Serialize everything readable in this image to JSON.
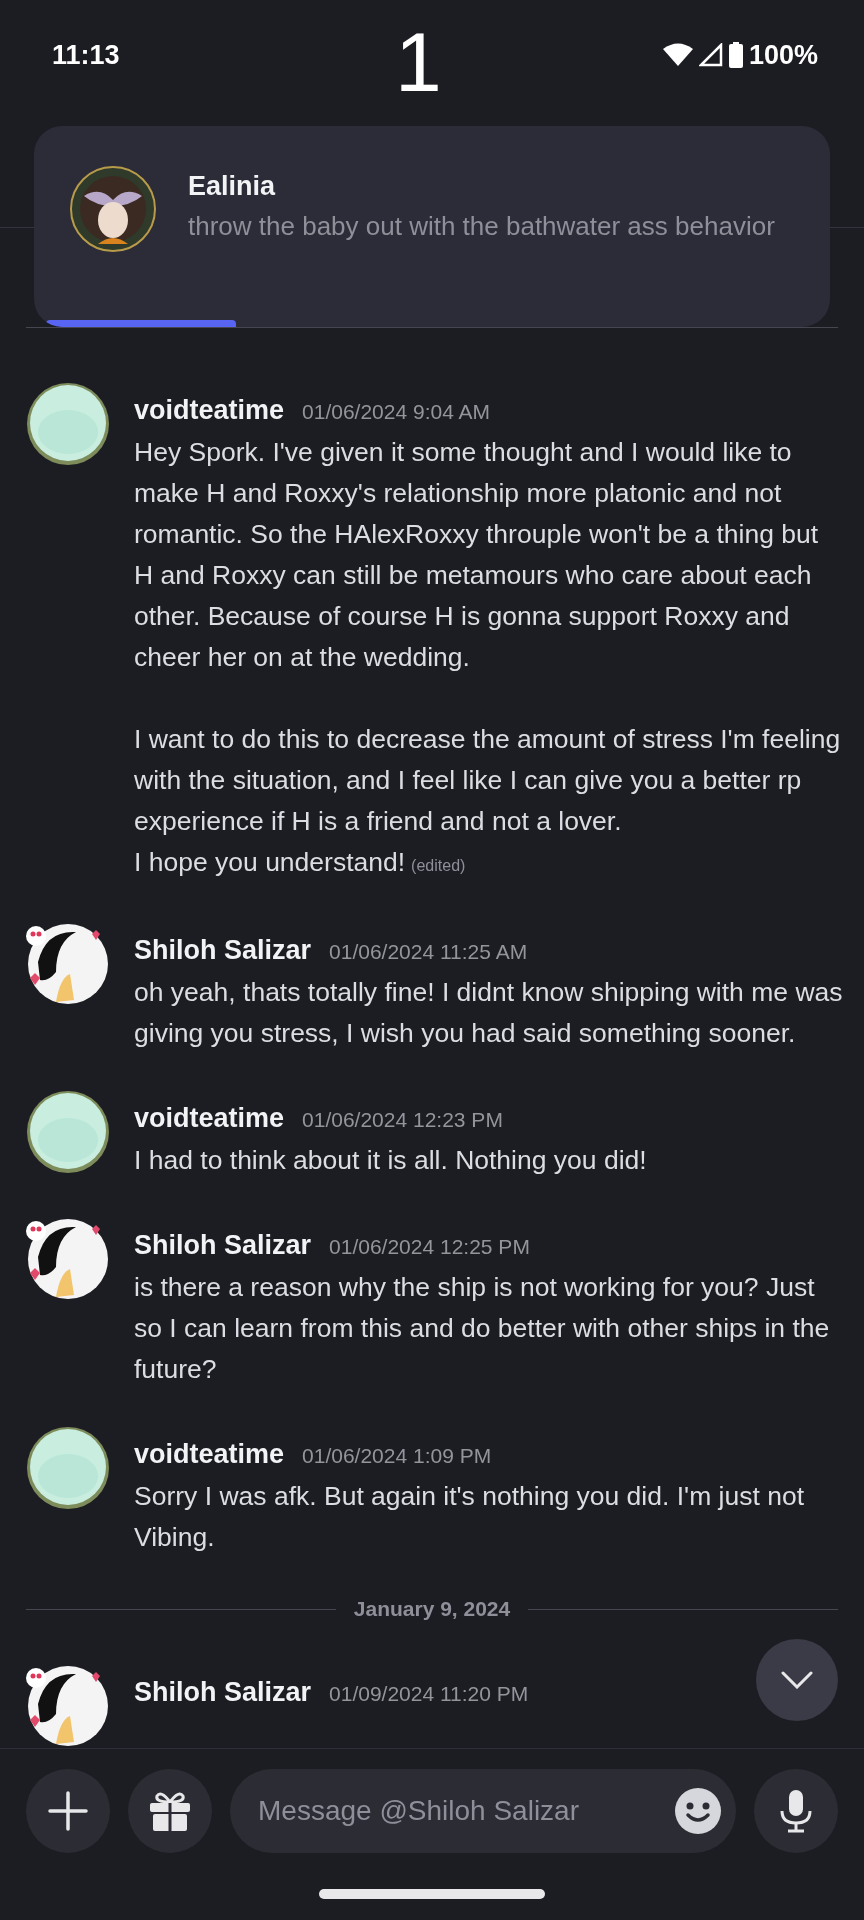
{
  "status_bar": {
    "time": "11:13",
    "center_text": "1",
    "battery": "100%"
  },
  "notification": {
    "author": "Ealinia",
    "text": "throw the baby out with the bathwater ass behavior"
  },
  "feed": [
    {
      "kind": "rule"
    },
    {
      "kind": "message",
      "avatar": {
        "kind": "mint"
      },
      "author": "voidteatime",
      "time": "01/06/2024 9:04 AM",
      "text": "Hey Spork. I've given it some thought and I would like to make H and Roxxy's relationship more platonic and not romantic. So the HAlexRoxxy throuple won't be a thing but H and Roxxy can still be metamours who care about each other. Because of course H is gonna support Roxxy and cheer her on at the wedding.\n\nI want to do this to decrease the amount of stress I'm feeling with the situation, and I feel like I can give you a better rp experience if H is a friend and not a lover.\nI hope you understand!",
      "edited_label": "(edited)"
    },
    {
      "kind": "message",
      "avatar": {
        "kind": "sketch"
      },
      "author": "Shiloh Salizar",
      "time": "01/06/2024 11:25 AM",
      "text": "oh yeah, thats totally fine! I didnt know shipping with me was giving you stress, I wish you had said something sooner."
    },
    {
      "kind": "message",
      "avatar": {
        "kind": "mint"
      },
      "author": "voidteatime",
      "time": "01/06/2024 12:23 PM",
      "text": "I had to think about it is all. Nothing you did!"
    },
    {
      "kind": "message",
      "avatar": {
        "kind": "sketch"
      },
      "author": "Shiloh Salizar",
      "time": "01/06/2024 12:25 PM",
      "text": "is there a reason why the ship is not working for you? Just so I can learn from this and do better with other ships in the future?"
    },
    {
      "kind": "message",
      "avatar": {
        "kind": "mint"
      },
      "author": "voidteatime",
      "time": "01/06/2024 1:09 PM",
      "text": "Sorry I was afk. But again it's nothing you did. I'm just not Vibing."
    },
    {
      "kind": "date",
      "text": "January 9, 2024"
    },
    {
      "kind": "message",
      "avatar": {
        "kind": "sketch"
      },
      "author": "Shiloh Salizar",
      "time": "01/09/2024 11:20 PM"
    }
  ],
  "composer": {
    "placeholder": "Message @Shiloh Salizar"
  }
}
